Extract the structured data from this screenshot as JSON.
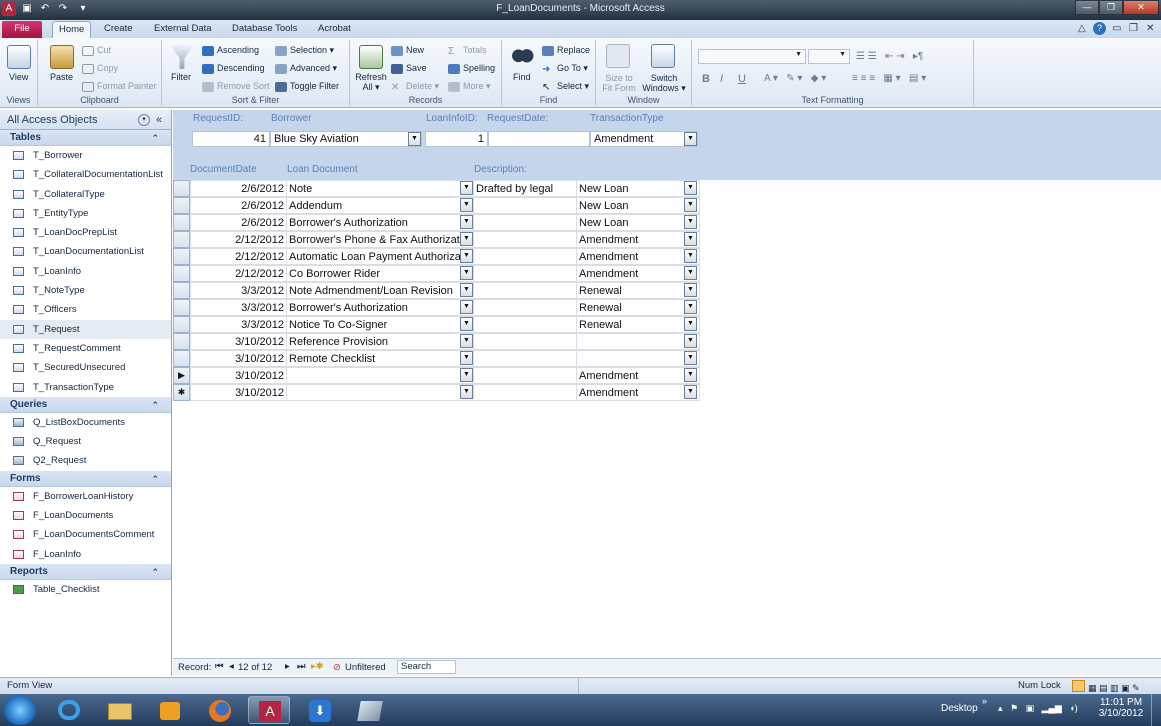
{
  "window": {
    "title": "F_LoanDocuments - Microsoft Access"
  },
  "tabs": [
    {
      "label": "File"
    },
    {
      "label": "Home"
    },
    {
      "label": "Create"
    },
    {
      "label": "External Data"
    },
    {
      "label": "Database Tools"
    },
    {
      "label": "Acrobat"
    }
  ],
  "ribbon": {
    "views": {
      "view": "View",
      "group": "Views"
    },
    "clipboard": {
      "paste": "Paste",
      "cut": "Cut",
      "copy": "Copy",
      "format_painter": "Format Painter",
      "group": "Clipboard"
    },
    "sort_filter": {
      "filter": "Filter",
      "ascending": "Ascending",
      "descending": "Descending",
      "remove_sort": "Remove Sort",
      "selection": "Selection ▾",
      "advanced": "Advanced ▾",
      "toggle_filter": "Toggle Filter",
      "group": "Sort & Filter"
    },
    "records": {
      "refresh": "Refresh",
      "refresh2": "All ▾",
      "new": "New",
      "save": "Save",
      "delete": "Delete ▾",
      "totals": "Totals",
      "spelling": "Spelling",
      "more": "More ▾",
      "group": "Records"
    },
    "find": {
      "find": "Find",
      "replace": "Replace",
      "goto": "Go To ▾",
      "select": "Select ▾",
      "group": "Find"
    },
    "window": {
      "size_to_fit": "Size to",
      "size_to_fit2": "Fit Form",
      "switch": "Switch",
      "switch2": "Windows ▾",
      "group": "Window"
    },
    "text": {
      "bold": "B",
      "italic": "I",
      "underline": "U",
      "group": "Text Formatting"
    }
  },
  "nav": {
    "title": "All Access Objects",
    "sections": [
      {
        "name": "Tables",
        "items": [
          "T_Borrower",
          "T_CollateralDocumentationList",
          "T_CollateralType",
          "T_EntityType",
          "T_LoanDocPrepList",
          "T_LoanDocumentationList",
          "T_LoanInfo",
          "T_NoteType",
          "T_Officers",
          "T_Request",
          "T_RequestComment",
          "T_SecuredUnsecured",
          "T_TransactionType"
        ]
      },
      {
        "name": "Queries",
        "items": [
          "Q_ListBoxDocuments",
          "Q_Request",
          "Q2_Request"
        ]
      },
      {
        "name": "Forms",
        "items": [
          "F_BorrowerLoanHistory",
          "F_LoanDocuments",
          "F_LoanDocumentsComment",
          "F_LoanInfo"
        ]
      },
      {
        "name": "Reports",
        "items": [
          "Table_Checklist"
        ]
      }
    ],
    "selected": "T_Request"
  },
  "form": {
    "labels": {
      "request_id": "RequestID:",
      "borrower": "Borrower",
      "loaninfo_id": "LoanInfoID:",
      "request_date": "RequestDate:",
      "transaction_type": "TransactionType",
      "document_date": "DocumentDate",
      "loan_document": "Loan Document",
      "description": "Description:"
    },
    "values": {
      "request_id": "41",
      "borrower": "Blue Sky Aviation",
      "loaninfo_id": "1",
      "request_date": "",
      "transaction_type": "Amendment"
    },
    "rows": [
      {
        "date": "2/6/2012",
        "doc": "Note",
        "desc": "Drafted by legal",
        "type": "New Loan"
      },
      {
        "date": "2/6/2012",
        "doc": "Addendum",
        "desc": "",
        "type": "New Loan"
      },
      {
        "date": "2/6/2012",
        "doc": "Borrower's Authorization",
        "desc": "",
        "type": "New Loan"
      },
      {
        "date": "2/12/2012",
        "doc": "Borrower's Phone & Fax Authorizat",
        "desc": "",
        "type": "Amendment"
      },
      {
        "date": "2/12/2012",
        "doc": "Automatic Loan Payment Authoriza",
        "desc": "",
        "type": "Amendment"
      },
      {
        "date": "2/12/2012",
        "doc": "Co Borrower Rider",
        "desc": "",
        "type": "Amendment"
      },
      {
        "date": "3/3/2012",
        "doc": "Note Admendment/Loan Revision",
        "desc": "",
        "type": "Renewal"
      },
      {
        "date": "3/3/2012",
        "doc": "Borrower's Authorization",
        "desc": "",
        "type": "Renewal"
      },
      {
        "date": "3/3/2012",
        "doc": "Notice To Co-Signer",
        "desc": "",
        "type": "Renewal"
      },
      {
        "date": "3/10/2012",
        "doc": "Reference Provision",
        "desc": "",
        "type": ""
      },
      {
        "date": "3/10/2012",
        "doc": "Remote Checklist",
        "desc": "",
        "type": ""
      },
      {
        "date": "3/10/2012",
        "doc": "",
        "desc": "",
        "type": "Amendment"
      },
      {
        "date": "3/10/2012",
        "doc": "",
        "desc": "",
        "type": "Amendment"
      }
    ],
    "current_marker": "▶",
    "new_marker": "✱"
  },
  "record_nav": {
    "label": "Record:",
    "position": "12 of 12",
    "filter": "Unfiltered",
    "search": "Search"
  },
  "status": {
    "left": "Form View",
    "numlock": "Num Lock"
  },
  "taskbar": {
    "desktop": "Desktop",
    "time": "11:01 PM",
    "date": "3/10/2012"
  },
  "colors": {
    "accent_file": "#c42557",
    "header_band": "#c5d6ec",
    "label_blue": "#5a80b6"
  }
}
